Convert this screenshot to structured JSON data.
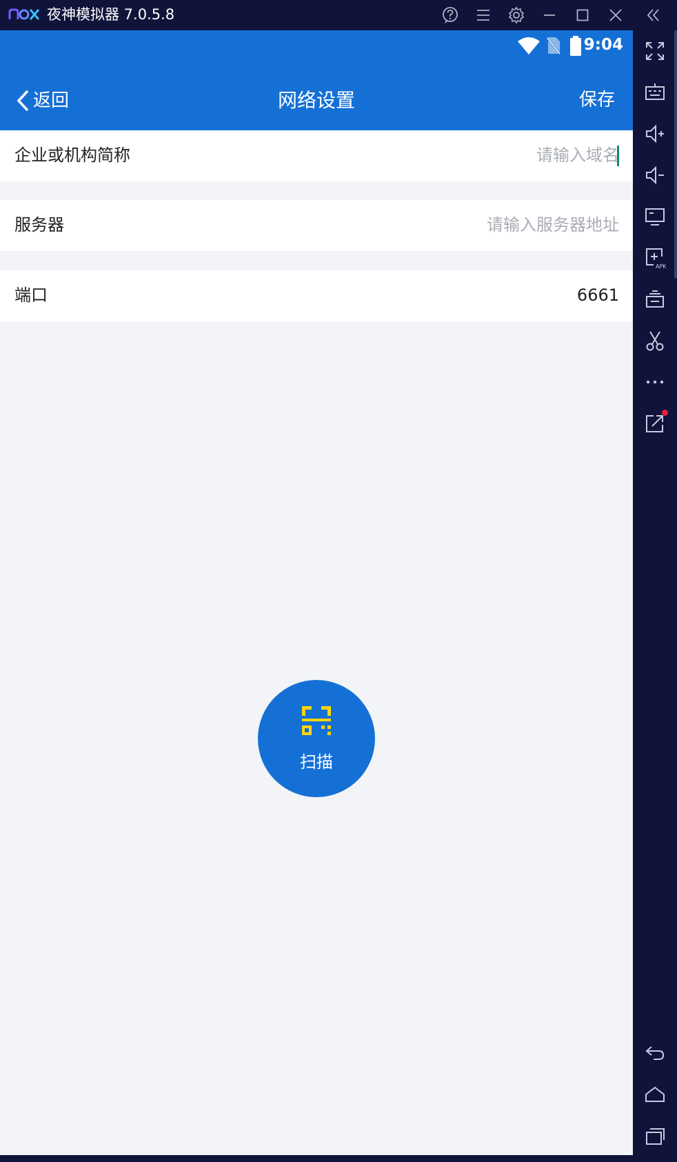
{
  "emulator": {
    "title": "夜神模拟器 7.0.5.8",
    "titlebar_icons": [
      "help-icon",
      "menu-icon",
      "settings-icon",
      "minimize-icon",
      "maximize-icon",
      "close-icon",
      "collapse-sidebar-icon"
    ],
    "sidebar_icons": [
      "fullscreen-icon",
      "keyboard-icon",
      "volume-up-icon",
      "volume-down-icon",
      "screen-icon",
      "add-apk-icon",
      "multi-instance-icon",
      "screenshot-icon",
      "more-icon",
      "external-link-icon",
      "back-icon",
      "home-icon",
      "recent-apps-icon"
    ],
    "theme": {
      "bar_bg": "#10143a",
      "notification_dot": "#e5213a"
    }
  },
  "status_bar": {
    "time": "9:04"
  },
  "nav": {
    "back_label": "返回",
    "title": "网络设置",
    "save_label": "保存",
    "color": "#1570d6"
  },
  "form": {
    "org": {
      "label": "企业或机构简称",
      "placeholder": "请输入域名",
      "value": ""
    },
    "server": {
      "label": "服务器",
      "placeholder": "请输入服务器地址",
      "value": ""
    },
    "port": {
      "label": "端口",
      "placeholder": "",
      "value": "6661"
    }
  },
  "scan": {
    "label": "扫描",
    "icon_color": "#ffd500"
  }
}
